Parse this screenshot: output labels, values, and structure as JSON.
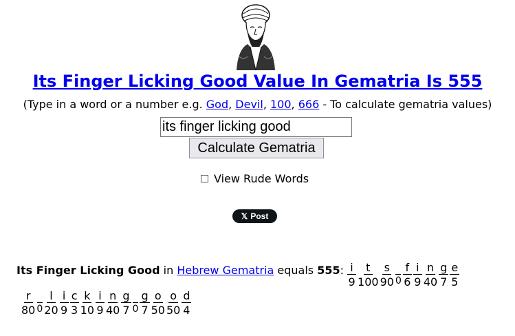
{
  "header": {
    "title": "Its Finger Licking Good Value In Gematria Is 555",
    "hint_prefix": "(Type in a word or a number e.g. ",
    "hint_links": [
      "God",
      "Devil",
      "100",
      "666"
    ],
    "hint_suffix": " - To calculate gematria values)"
  },
  "form": {
    "search_value": "its finger licking good",
    "calculate_label": "Calculate Gematria",
    "rude_words_label": "View Rude Words",
    "rude_words_checked": false
  },
  "share": {
    "post_label": "Post",
    "icon": "x-logo-icon"
  },
  "result": {
    "phrase": "Its Finger Licking Good",
    "in_text": " in ",
    "cipher_link": "Hebrew Gematria",
    "equals_text": " equals ",
    "total": "555",
    "colon": ":",
    "letters": [
      {
        "ch": "i",
        "v": "9"
      },
      {
        "ch": "t",
        "v": "100"
      },
      {
        "ch": "s",
        "v": "90"
      },
      {
        "ch": "_",
        "v": "0"
      },
      {
        "ch": "f",
        "v": "6"
      },
      {
        "ch": "i",
        "v": "9"
      },
      {
        "ch": "n",
        "v": "40"
      },
      {
        "ch": "g",
        "v": "7"
      },
      {
        "ch": "e",
        "v": "5"
      },
      {
        "ch": "r",
        "v": "80"
      },
      {
        "ch": "_",
        "v": "0"
      },
      {
        "ch": "l",
        "v": "20"
      },
      {
        "ch": "i",
        "v": "9"
      },
      {
        "ch": "c",
        "v": "3"
      },
      {
        "ch": "k",
        "v": "10"
      },
      {
        "ch": "i",
        "v": "9"
      },
      {
        "ch": "n",
        "v": "40"
      },
      {
        "ch": "g",
        "v": "7"
      },
      {
        "ch": "_",
        "v": "0"
      },
      {
        "ch": "g",
        "v": "7"
      },
      {
        "ch": "o",
        "v": "50"
      },
      {
        "ch": "o",
        "v": "50"
      },
      {
        "ch": "d",
        "v": "4"
      }
    ],
    "first_row_count": 9
  }
}
